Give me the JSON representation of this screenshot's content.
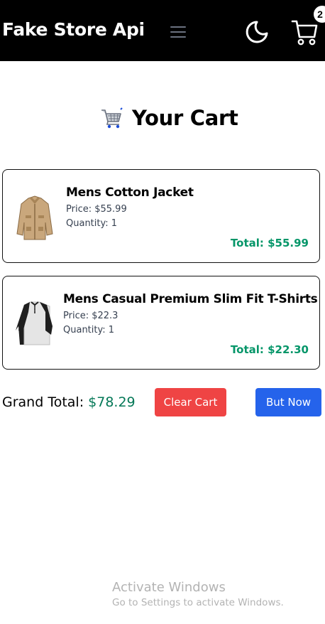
{
  "navbar": {
    "brand": "Fake Store Api",
    "menu_icon": "hamburger-menu-icon",
    "theme_icon": "moon-icon",
    "cart_icon": "shopping-cart-icon",
    "cart_count": "2"
  },
  "heading": {
    "icon": "shopping-cart-emoji-icon",
    "title": "Your Cart"
  },
  "cart": {
    "items": [
      {
        "title": "Mens Cotton Jacket",
        "price": "Price: $55.99",
        "quantity": "Quantity: 1",
        "total": "Total: $55.99",
        "image_icon": "cotton-jacket-image"
      },
      {
        "title": "Mens Casual Premium Slim Fit T-Shirts",
        "price": "Price: $22.3",
        "quantity": "Quantity: 1",
        "total": "Total: $22.30",
        "image_icon": "raglan-tshirt-image"
      }
    ]
  },
  "summary": {
    "grand_total_label": "Grand Total:",
    "grand_total_value": "$78.29",
    "clear_label": "Clear Cart",
    "buy_label": "But Now"
  },
  "watermark": {
    "title": "Activate Windows",
    "subtitle": "Go to Settings to activate Windows."
  },
  "colors": {
    "navbar_bg": "#000000",
    "total_green": "#059669",
    "clear_button": "#ef4444",
    "buy_button": "#2563eb"
  }
}
